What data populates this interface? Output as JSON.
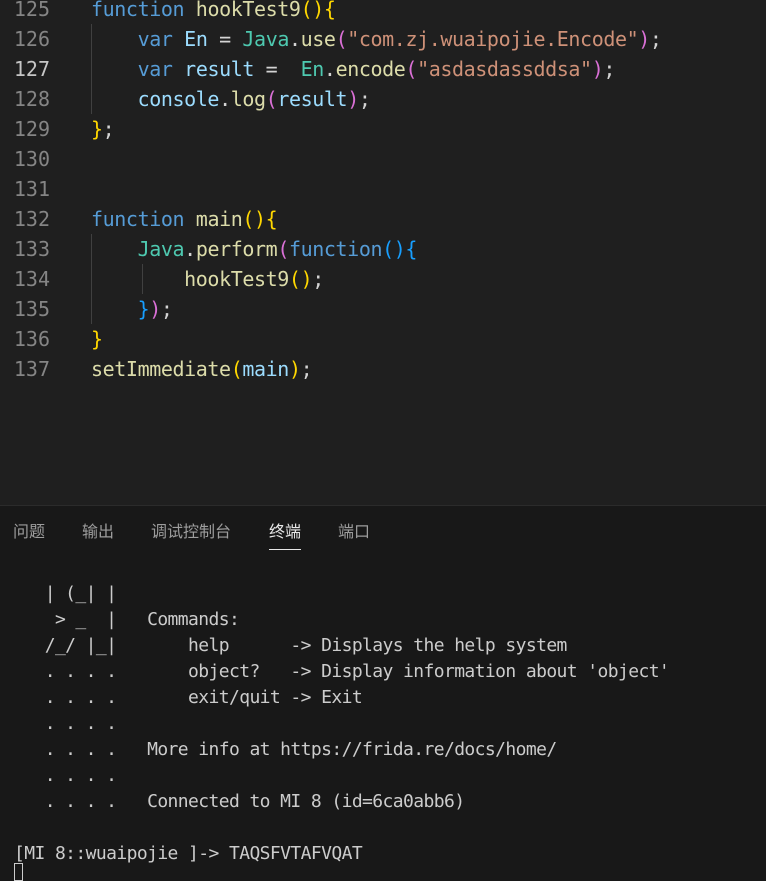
{
  "editor": {
    "active_line": "127",
    "lines": [
      {
        "number": "125",
        "tokens": [
          [
            "kw",
            "function"
          ],
          [
            "pun",
            " "
          ],
          [
            "fn",
            "hookTest9"
          ],
          [
            "b1",
            "()"
          ],
          [
            "b1",
            "{"
          ]
        ]
      },
      {
        "number": "126",
        "tokens": [
          [
            "pun",
            "    "
          ],
          [
            "kw",
            "var"
          ],
          [
            "pun",
            " "
          ],
          [
            "var",
            "En"
          ],
          [
            "pun",
            " = "
          ],
          [
            "cls",
            "Java"
          ],
          [
            "pun",
            "."
          ],
          [
            "fn",
            "use"
          ],
          [
            "b2",
            "("
          ],
          [
            "str",
            "\"com.zj.wuaipojie.Encode\""
          ],
          [
            "b2",
            ")"
          ],
          [
            "pun",
            ";"
          ]
        ]
      },
      {
        "number": "127",
        "tokens": [
          [
            "pun",
            "    "
          ],
          [
            "kw",
            "var"
          ],
          [
            "pun",
            " "
          ],
          [
            "var",
            "result"
          ],
          [
            "pun",
            " =  "
          ],
          [
            "cls",
            "En"
          ],
          [
            "pun",
            "."
          ],
          [
            "fn",
            "encode"
          ],
          [
            "b2",
            "("
          ],
          [
            "str",
            "\"asdasdassddsa\""
          ],
          [
            "b2",
            ")"
          ],
          [
            "pun",
            ";"
          ]
        ]
      },
      {
        "number": "128",
        "tokens": [
          [
            "pun",
            "    "
          ],
          [
            "var",
            "console"
          ],
          [
            "pun",
            "."
          ],
          [
            "fn",
            "log"
          ],
          [
            "b2",
            "("
          ],
          [
            "var",
            "result"
          ],
          [
            "b2",
            ")"
          ],
          [
            "pun",
            ";"
          ]
        ]
      },
      {
        "number": "129",
        "tokens": [
          [
            "b1",
            "}"
          ],
          [
            "pun",
            ";"
          ]
        ]
      },
      {
        "number": "130",
        "tokens": []
      },
      {
        "number": "131",
        "tokens": []
      },
      {
        "number": "132",
        "tokens": [
          [
            "kw",
            "function"
          ],
          [
            "pun",
            " "
          ],
          [
            "fn",
            "main"
          ],
          [
            "b1",
            "()"
          ],
          [
            "b1",
            "{"
          ]
        ]
      },
      {
        "number": "133",
        "tokens": [
          [
            "pun",
            "    "
          ],
          [
            "cls",
            "Java"
          ],
          [
            "pun",
            "."
          ],
          [
            "fn",
            "perform"
          ],
          [
            "b2",
            "("
          ],
          [
            "kw",
            "function"
          ],
          [
            "b3",
            "()"
          ],
          [
            "b3",
            "{"
          ]
        ]
      },
      {
        "number": "134",
        "tokens": [
          [
            "pun",
            "        "
          ],
          [
            "fn",
            "hookTest9"
          ],
          [
            "b1",
            "()"
          ],
          [
            "pun",
            ";"
          ]
        ]
      },
      {
        "number": "135",
        "tokens": [
          [
            "pun",
            "    "
          ],
          [
            "b3",
            "}"
          ],
          [
            "b2",
            ")"
          ],
          [
            "pun",
            ";"
          ]
        ]
      },
      {
        "number": "136",
        "tokens": [
          [
            "b1",
            "}"
          ]
        ]
      },
      {
        "number": "137",
        "tokens": [
          [
            "fn",
            "setImmediate"
          ],
          [
            "b1",
            "("
          ],
          [
            "var",
            "main"
          ],
          [
            "b1",
            ")"
          ],
          [
            "pun",
            ";"
          ]
        ]
      }
    ]
  },
  "panel": {
    "tabs": [
      {
        "label": "问题",
        "active": false
      },
      {
        "label": "输出",
        "active": false
      },
      {
        "label": "调试控制台",
        "active": false
      },
      {
        "label": "终端",
        "active": true
      },
      {
        "label": "端口",
        "active": false
      }
    ]
  },
  "terminal": {
    "lines": [
      "   | (_| |",
      "    > _  |   Commands:",
      "   /_/ |_|       help      -> Displays the help system",
      "   . . . .       object?   -> Display information about 'object'",
      "   . . . .       exit/quit -> Exit",
      "   . . . .",
      "   . . . .   More info at https://frida.re/docs/home/",
      "   . . . .",
      "   . . . .   Connected to MI 8 (id=6ca0abb6)",
      "",
      "[MI 8::wuaipojie ]-> TAQSFVTAFVQAT"
    ]
  },
  "colors": {
    "editor_bg": "#1f1f1f",
    "keyword": "#569cd6",
    "function": "#dcdcaa",
    "variable": "#9cdcfe",
    "class": "#4ec9b0",
    "string": "#ce9178",
    "bracket_1": "#ffd700",
    "bracket_2": "#da70d6",
    "bracket_3": "#179fff",
    "terminal_text": "#cccccc",
    "panel_bg": "#181818"
  }
}
